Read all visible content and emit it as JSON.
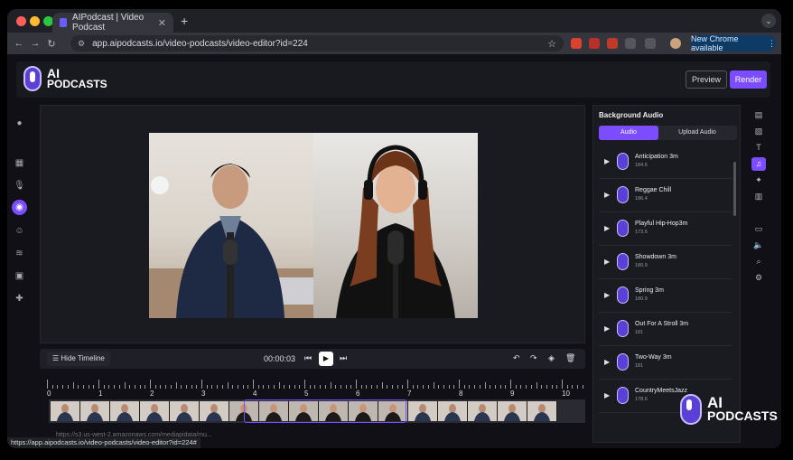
{
  "browser": {
    "tab_title": "AIPodcast | Video Podcast",
    "url": "app.aipodcasts.io/video-podcasts/video-editor?id=224",
    "new_chrome": "New Chrome available",
    "status_url": "https://app.aipodcasts.io/video-podcasts/video-editor?id=224#",
    "faint_row": "https://s3.us-west-2.amazonaws.com/mediapidata/mu..."
  },
  "app": {
    "logo_ai": "AI",
    "logo_podcasts": "PODCASTS",
    "preview_label": "Preview",
    "render_label": "Render"
  },
  "timeline": {
    "hide_label": "Hide Timeline",
    "current_time": "00:00:03",
    "ruler_labels": [
      "0",
      "1",
      "2",
      "3",
      "4",
      "5",
      "6",
      "7",
      "8",
      "9",
      "10"
    ]
  },
  "panel": {
    "title": "Background Audio",
    "tab_audio": "Audio",
    "tab_upload": "Upload Audio",
    "tracks": [
      {
        "name": "Anticipation 3m",
        "meta": "184.6"
      },
      {
        "name": "Reggae Chill",
        "meta": "186.4"
      },
      {
        "name": "Playful Hip-Hop3m",
        "meta": "173.6"
      },
      {
        "name": "Showdown 3m",
        "meta": "180.9"
      },
      {
        "name": "Spring 3m",
        "meta": "180.9"
      },
      {
        "name": "Out For A Stroll 3m",
        "meta": "181"
      },
      {
        "name": "Two-Way 3m",
        "meta": "181"
      },
      {
        "name": "CountryMeetsJazz",
        "meta": "178.6"
      }
    ]
  },
  "watermark": {
    "ai": "AI",
    "podcasts": "PODCASTS"
  },
  "colors": {
    "accent": "#7c4dff",
    "background": "#101016",
    "panel": "#1a1a21"
  }
}
